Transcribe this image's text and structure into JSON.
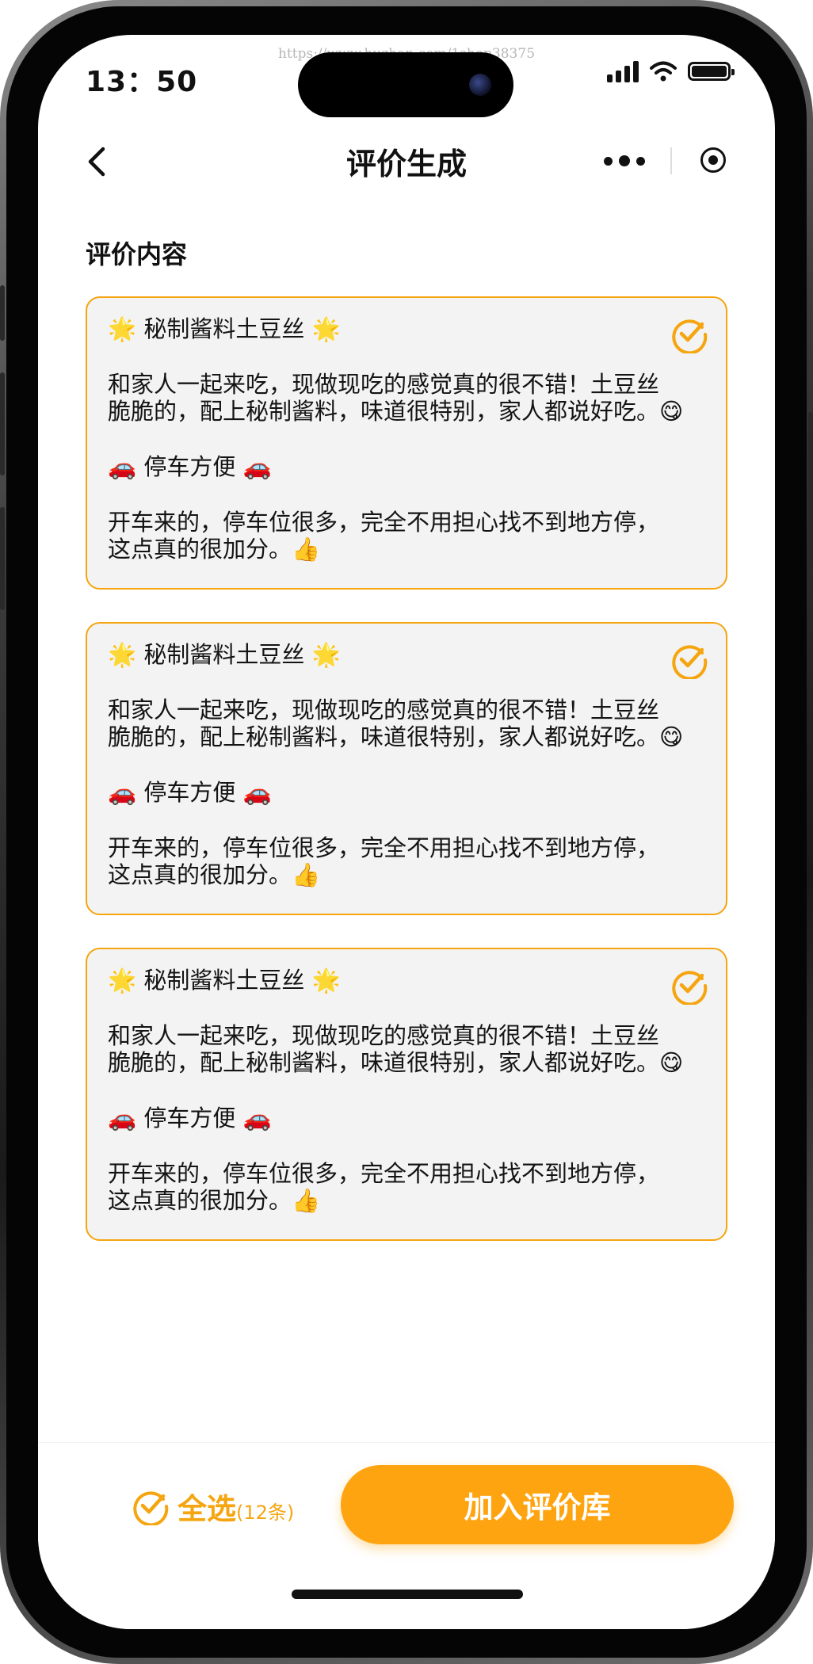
{
  "status_bar": {
    "time": "13：50",
    "watermark": "https://www.huzhan.com/1shop38375"
  },
  "nav": {
    "title": "评价生成",
    "back_icon": "chevron-left-icon",
    "more_icon": "more-dots-icon",
    "record_icon": "record-icon"
  },
  "section": {
    "title": "评价内容"
  },
  "cards": [
    {
      "line1": "🌟 秘制酱料土豆丝 🌟",
      "line2": "和家人一起来吃，现做现吃的感觉真的很不错！土豆丝",
      "line3": "脆脆的，配上秘制酱料，味道很特别，家人都说好吃。😋",
      "line4": "🚗 停车方便 🚗",
      "line5": "开车来的，停车位很多，完全不用担心找不到地方停，",
      "line6": "这点真的很加分。👍",
      "selected": true
    },
    {
      "line1": "🌟 秘制酱料土豆丝 🌟",
      "line2": "和家人一起来吃，现做现吃的感觉真的很不错！土豆丝",
      "line3": "脆脆的，配上秘制酱料，味道很特别，家人都说好吃。😋",
      "line4": "🚗 停车方便 🚗",
      "line5": "开车来的，停车位很多，完全不用担心找不到地方停，",
      "line6": "这点真的很加分。👍",
      "selected": true
    },
    {
      "line1": "🌟 秘制酱料土豆丝 🌟",
      "line2": "和家人一起来吃，现做现吃的感觉真的很不错！土豆丝",
      "line3": "脆脆的，配上秘制酱料，味道很特别，家人都说好吃。😋",
      "line4": "🚗 停车方便 🚗",
      "line5": "开车来的，停车位很多，完全不用担心找不到地方停，",
      "line6": "这点真的很加分。👍",
      "selected": true
    }
  ],
  "bottom": {
    "select_all_label": "全选",
    "select_all_count": "(12条)",
    "add_button_label": "加入评价库"
  },
  "colors": {
    "accent": "#ffa411",
    "card_border": "#f5a50f",
    "card_bg": "#f3f3f3"
  }
}
